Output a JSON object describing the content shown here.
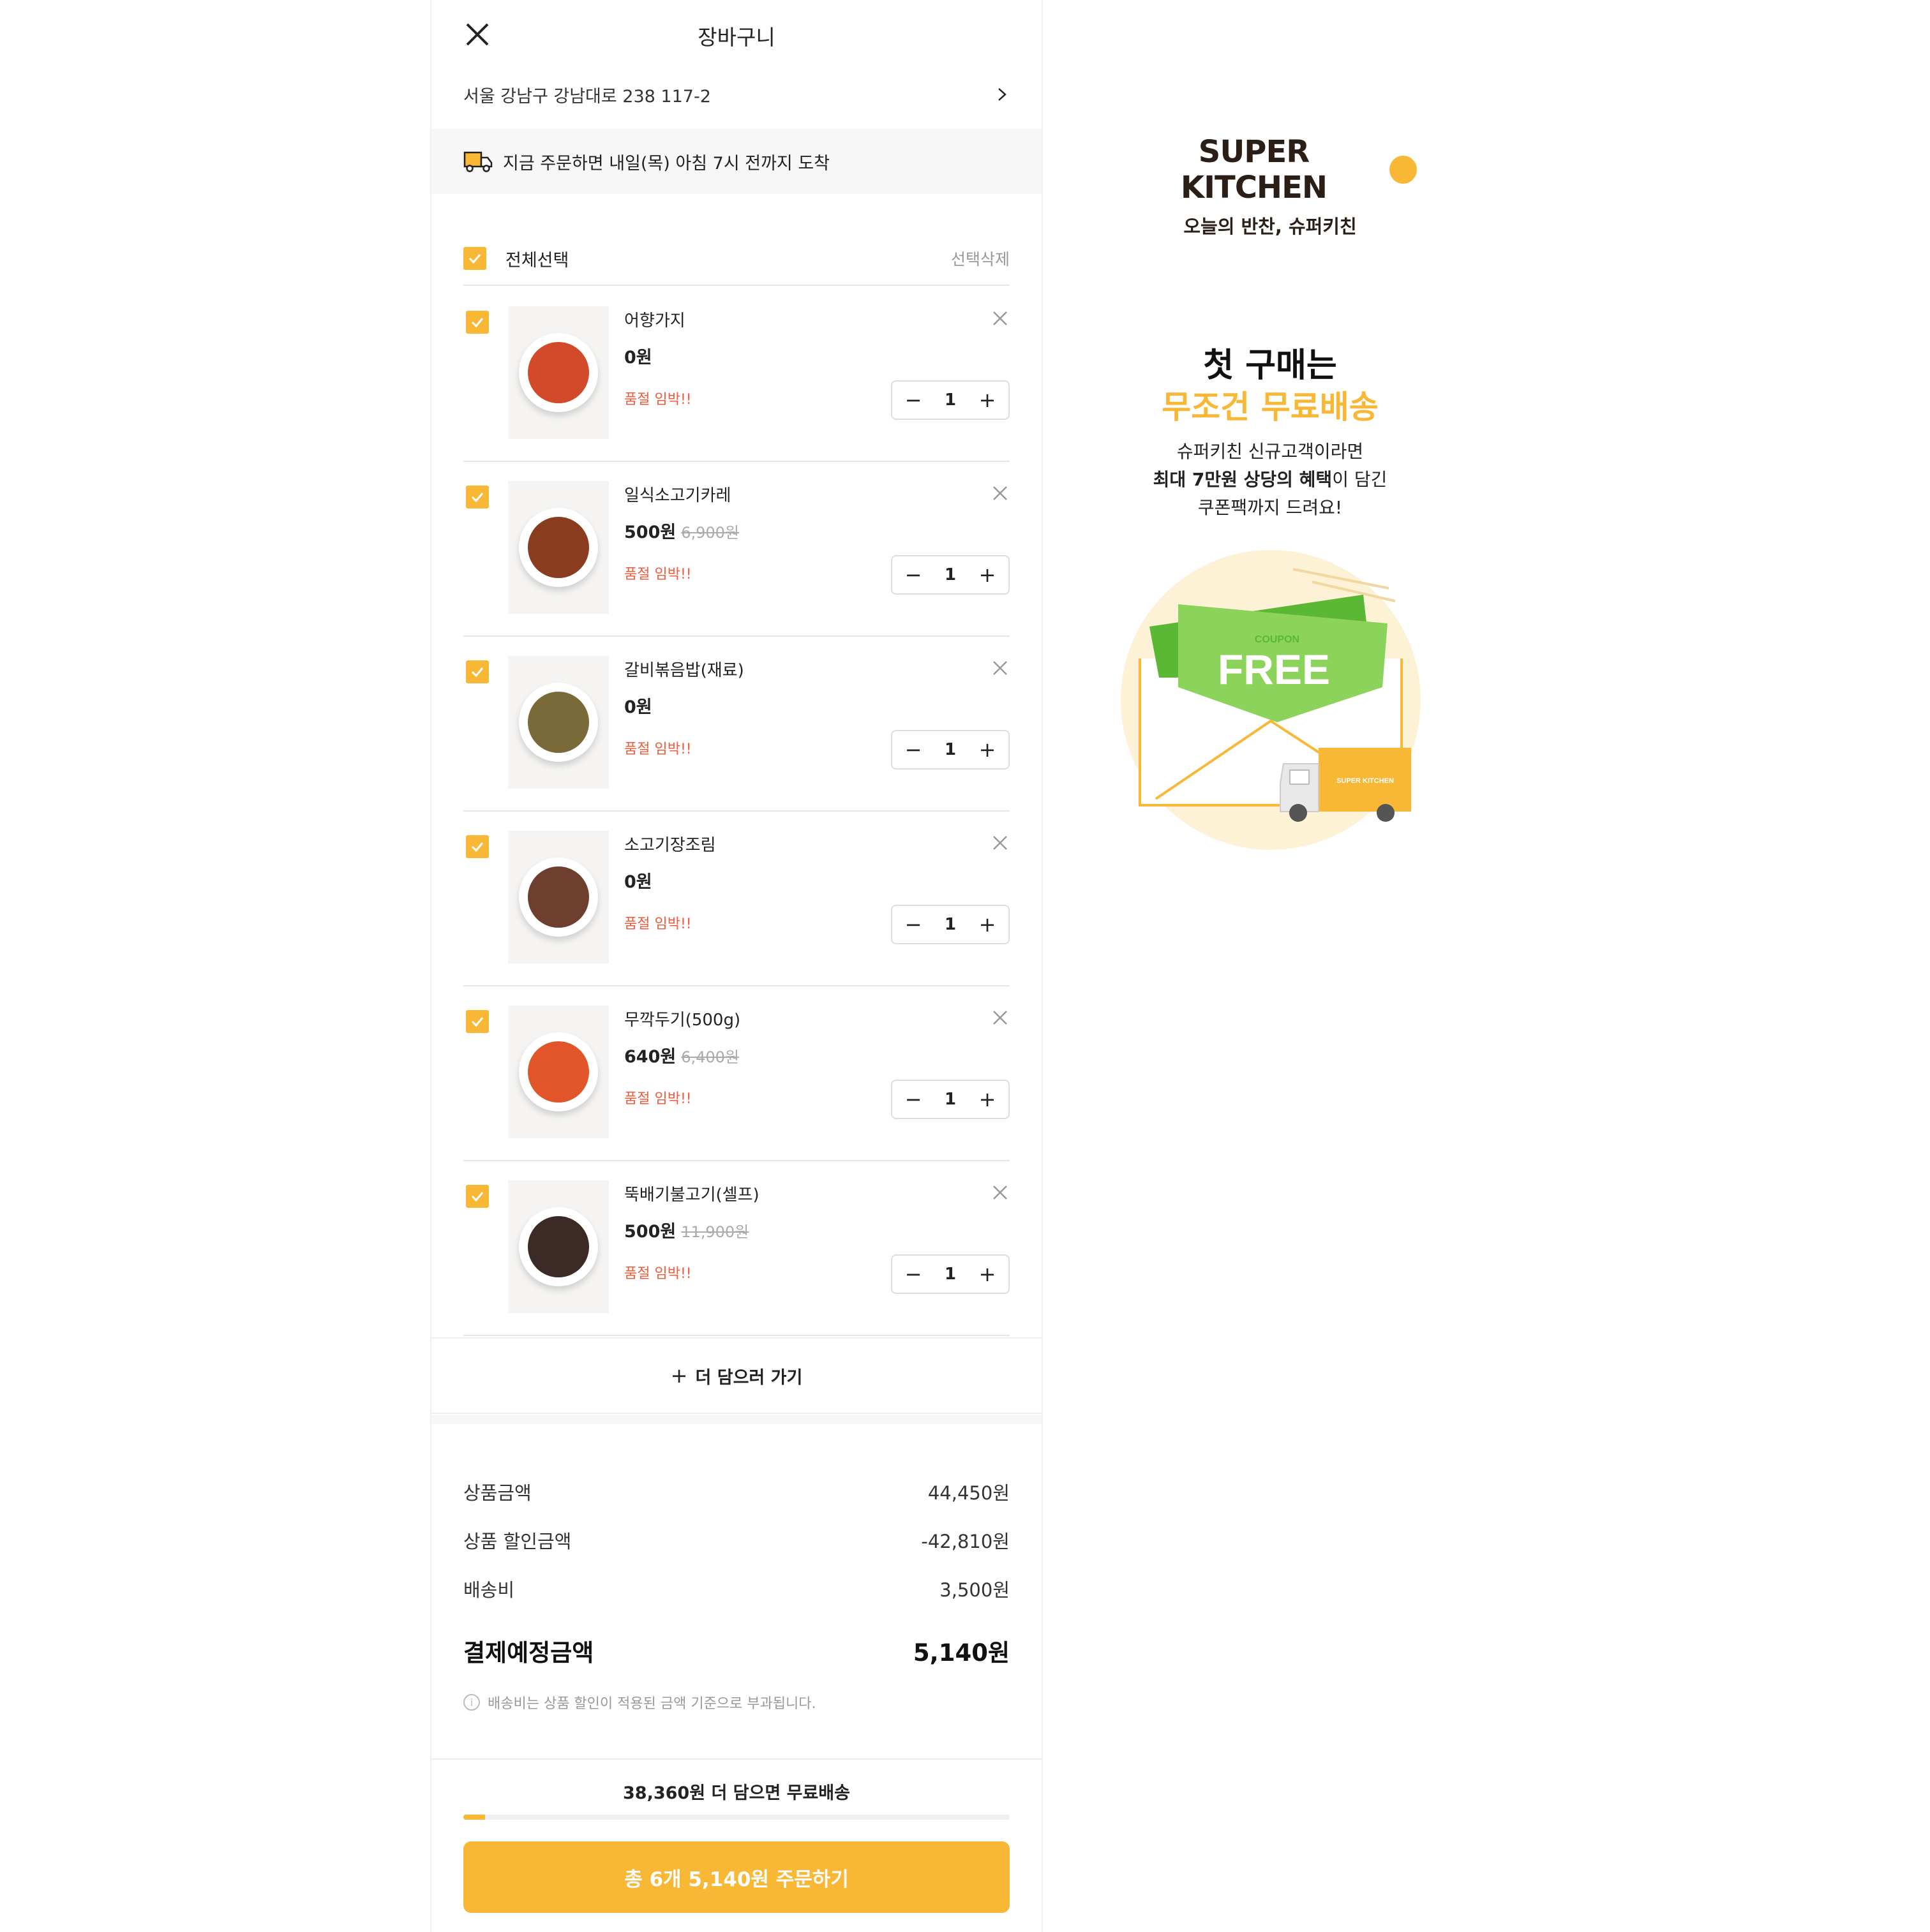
{
  "header": {
    "title": "장바구니"
  },
  "address": {
    "text": "서울 강남구 강남대로 238 117-2"
  },
  "notice": {
    "text": "지금 주문하면 내일(목) 아침 7시 전까지 도착"
  },
  "select": {
    "all_label": "전체선택",
    "delete_label": "선택삭제"
  },
  "items": [
    {
      "name": "어향가지",
      "price": "0원",
      "original": "",
      "badge": "품절 임박!!",
      "qty": "1",
      "food_color": "#d34a2a"
    },
    {
      "name": "일식소고기카레",
      "price": "500원",
      "original": "6,900원",
      "badge": "품절 임박!!",
      "qty": "1",
      "food_color": "#8a3c1f"
    },
    {
      "name": "갈비볶음밥(재료)",
      "price": "0원",
      "original": "",
      "badge": "품절 임박!!",
      "qty": "1",
      "food_color": "#7a6a3a"
    },
    {
      "name": "소고기장조림",
      "price": "0원",
      "original": "",
      "badge": "품절 임박!!",
      "qty": "1",
      "food_color": "#6e3f2e"
    },
    {
      "name": "무깍두기(500g)",
      "price": "640원",
      "original": "6,400원",
      "badge": "품절 임박!!",
      "qty": "1",
      "food_color": "#e2552a"
    },
    {
      "name": "뚝배기불고기(셀프)",
      "price": "500원",
      "original": "11,900원",
      "badge": "품절 임박!!",
      "qty": "1",
      "food_color": "#3b2a25"
    }
  ],
  "more": {
    "label": "더 담으러 가기"
  },
  "summary": {
    "rows": [
      {
        "label": "상품금액",
        "value": "44,450원"
      },
      {
        "label": "상품 할인금액",
        "value": "-42,810원"
      },
      {
        "label": "배송비",
        "value": "3,500원"
      }
    ],
    "total_label": "결제예정금액",
    "total_value": "5,140원",
    "info": "배송비는 상품 할인이 적용된 금액 기준으로 부과됩니다."
  },
  "bottom": {
    "free_ship_text": "38,360원 더 담으면 무료배송",
    "progress_fraction": 0.04,
    "order_label": "총 6개 5,140원 주문하기"
  },
  "promo": {
    "brand": "SUPER KITCHEN",
    "tagline": "오늘의 반찬, 슈퍼키친",
    "headline1": "첫 구매는",
    "headline2": "무조건 무료배송",
    "line1": "슈퍼키친 신규고객이라면",
    "line2_bold": "최대 7만원 상당의 혜택",
    "line2_rest": "이 담긴",
    "line3": "쿠폰팩까지 드려요!",
    "coupon_small": "COUPON",
    "coupon_big": "FREE",
    "truck_label": "SUPER KITCHEN"
  },
  "colors": {
    "accent": "#f8b734",
    "warning": "#f15a3a",
    "coupon_green": "#8bd35a"
  }
}
